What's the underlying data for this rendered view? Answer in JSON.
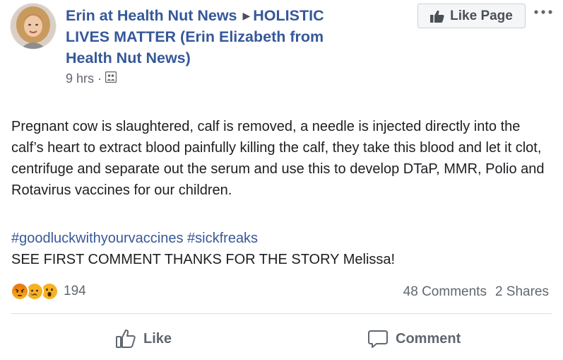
{
  "post": {
    "author": {
      "page_name": "Erin at Health Nut News",
      "separator_icon": "right-triangle-icon",
      "target_group": "HOLISTIC LIVES MATTER (Erin Elizabeth from Health Nut News)"
    },
    "timestamp": "9 hrs",
    "meta_separator": "·",
    "privacy_icon": "group-audience-icon",
    "like_page_button": "Like Page",
    "more_icon": "more-options-icon",
    "body": "Pregnant cow is slaughtered, calf is removed, a needle is injected directly into the calf’s heart to extract blood painfully killing the calf, they take this blood and let it clot, centrifuge and separate out the serum and use this to develop DTaP, MMR, Polio and Rotavirus vaccines for our children.",
    "hashtags": [
      "#goodluckwithyourvaccines",
      "#sickfreaks"
    ],
    "see_first_comment": "SEE FIRST COMMENT THANKS FOR THE STORY Melissa!",
    "reactions": {
      "icons": [
        "angry-reaction-icon",
        "sad-reaction-icon",
        "wow-reaction-icon"
      ],
      "count": "194"
    },
    "comments_count": "48 Comments",
    "shares_count": "2 Shares",
    "actions": {
      "like_label": "Like",
      "comment_label": "Comment"
    }
  },
  "colors": {
    "link_blue": "#365899",
    "hashtag_blue": "#385898",
    "text": "#1c1e21",
    "secondary_text": "#606770",
    "angry": "#e9710f",
    "sad_wow": "#f7b125",
    "divider": "#dadde1"
  }
}
